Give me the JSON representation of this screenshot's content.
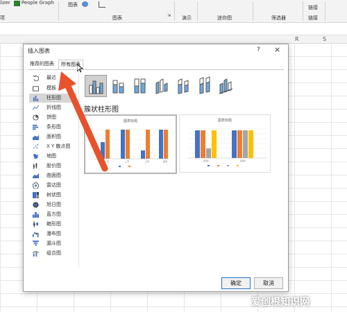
{
  "ribbon": {
    "left_partial": "lizer",
    "people_graph": "People Graph",
    "chart_btn": "图表",
    "partial_bottom_left": "项",
    "group_charts": "图表",
    "group_demo": "演示",
    "group_sparklines": "迷你图",
    "group_filters": "筛选器",
    "group_links": "链接",
    "link_btn": "链接"
  },
  "column_headers": [
    "R",
    "S"
  ],
  "dialog": {
    "title": "插入图表",
    "help": "?",
    "close": "×",
    "tabs": [
      "推荐的图表",
      "所有图表"
    ],
    "categories": [
      {
        "label": "最近",
        "icon": "undo-icon"
      },
      {
        "label": "模板",
        "icon": "folder-icon"
      },
      {
        "label": "柱形图",
        "icon": "column-chart-icon"
      },
      {
        "label": "折线图",
        "icon": "line-chart-icon"
      },
      {
        "label": "饼图",
        "icon": "pie-chart-icon"
      },
      {
        "label": "条形图",
        "icon": "bar-chart-icon"
      },
      {
        "label": "面积图",
        "icon": "area-chart-icon"
      },
      {
        "label": "X Y 散点图",
        "icon": "scatter-chart-icon"
      },
      {
        "label": "地图",
        "icon": "map-chart-icon"
      },
      {
        "label": "股价图",
        "icon": "stock-chart-icon"
      },
      {
        "label": "曲面图",
        "icon": "surface-chart-icon"
      },
      {
        "label": "雷达图",
        "icon": "radar-chart-icon"
      },
      {
        "label": "树状图",
        "icon": "treemap-chart-icon"
      },
      {
        "label": "旭日图",
        "icon": "sunburst-chart-icon"
      },
      {
        "label": "直方图",
        "icon": "histogram-chart-icon"
      },
      {
        "label": "箱形图",
        "icon": "box-whisker-chart-icon"
      },
      {
        "label": "瀑布图",
        "icon": "waterfall-chart-icon"
      },
      {
        "label": "漏斗图",
        "icon": "funnel-chart-icon"
      },
      {
        "label": "组合图",
        "icon": "combo-chart-icon"
      }
    ],
    "selected_category": "柱形图",
    "section_title": "簇状柱形图",
    "preview_title": "图表标题",
    "preview1_cats": [
      "一月",
      "二月",
      "三月",
      "四月"
    ],
    "preview2_cats": [
      "系列1",
      "系列2"
    ],
    "ok_label": "确定",
    "cancel_label": "取消"
  },
  "watermark": "爱创根知识网",
  "colors": {
    "blue": "#4472c4",
    "orange": "#ed7d31",
    "gray": "#a5a5a5",
    "gold": "#ffc000",
    "arrow": "#e8522a",
    "ok_border": "#2b6cc4"
  }
}
